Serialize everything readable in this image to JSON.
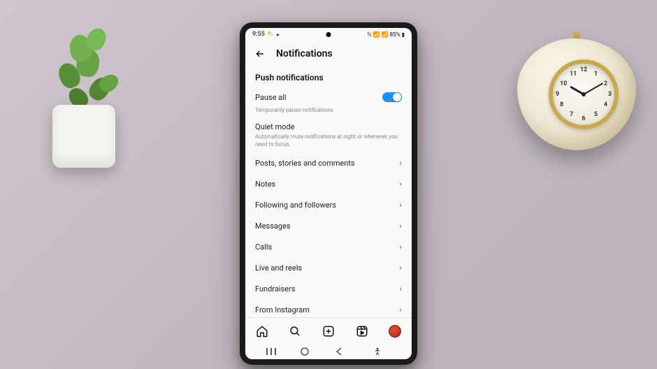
{
  "status_bar": {
    "time": "9:55",
    "battery_percent": "85%"
  },
  "header": {
    "title": "Notifications"
  },
  "section": {
    "push_title": "Push notifications"
  },
  "pause_all": {
    "label": "Pause all",
    "sub": "Temporarily pause notifications",
    "enabled": true
  },
  "quiet_mode": {
    "label": "Quiet mode",
    "sub": "Automatically mute notifications at night or whenever you need to focus."
  },
  "items": [
    {
      "label": "Posts, stories and comments"
    },
    {
      "label": "Notes"
    },
    {
      "label": "Following and followers"
    },
    {
      "label": "Messages"
    },
    {
      "label": "Calls"
    },
    {
      "label": "Live and reels"
    },
    {
      "label": "Fundraisers"
    },
    {
      "label": "From Instagram"
    }
  ],
  "clock": {
    "hour": 10,
    "minute": 10
  }
}
